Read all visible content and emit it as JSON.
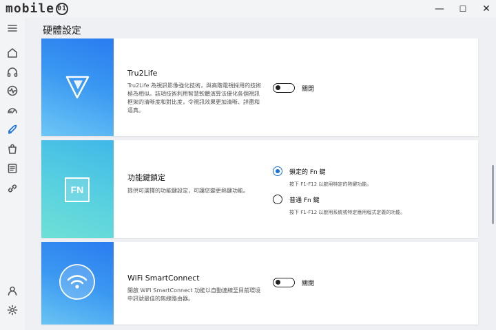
{
  "window": {
    "logo_text": "mobile",
    "logo_mark": "01",
    "minimize_glyph": "—",
    "maximize_glyph": "☐",
    "close_glyph": "✕"
  },
  "header": {
    "title": "硬體設定"
  },
  "nav": {
    "menu_icon": "hamburger-icon",
    "items": [
      {
        "icon": "home-icon"
      },
      {
        "icon": "headphones-icon"
      },
      {
        "icon": "activity-icon"
      },
      {
        "icon": "gauge-icon"
      },
      {
        "icon": "rocket-icon",
        "active": true
      },
      {
        "icon": "shopping-bag-icon"
      },
      {
        "icon": "document-icon"
      },
      {
        "icon": "link-icon"
      }
    ],
    "bottom": [
      {
        "icon": "user-icon"
      },
      {
        "icon": "settings-icon"
      }
    ]
  },
  "cards": {
    "tru2life": {
      "title": "Tru2Life",
      "description": "Tru2Life 為視訊影像強化技術，與高階電視採用的技術極為相似。該項技術利用智慧軟體演算法優化各個視訊框架的清晰度和對比度，令視訊效果更加清晰、詳盡和逼真。",
      "toggle_label": "關閉"
    },
    "fnlock": {
      "title": "功能鍵鎖定",
      "description": "提供可選擇的功能鍵設定，可讓您變更熱鍵功能。",
      "art_text": "FN",
      "option1_label": "鎖定的 Fn 鍵",
      "option1_desc": "按下 F1-F12 以啟用特定的熱鍵功能。",
      "option2_label": "普通 Fn 鍵",
      "option2_desc": "按下 F1-F12 以啟用系統或特定應用程式定義的功能。"
    },
    "wifi": {
      "title": "WiFi SmartConnect",
      "description": "開啟 WiFi SmartConnect 功能以自動連線至目前環境中訊號最佳的無線路由器。",
      "toggle_label": "關閉"
    }
  }
}
